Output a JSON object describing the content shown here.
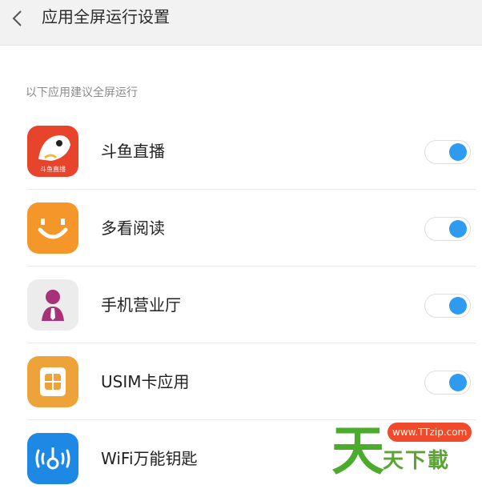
{
  "header": {
    "title": "应用全屏运行设置",
    "back_icon": "chevron-left-icon"
  },
  "section": {
    "label": "以下应用建议全屏运行"
  },
  "apps": [
    {
      "name": "斗鱼直播",
      "icon": "douyu-app-icon",
      "icon_caption": "斗鱼直播",
      "enabled": true
    },
    {
      "name": "多看阅读",
      "icon": "duokan-app-icon",
      "enabled": true
    },
    {
      "name": "手机营业厅",
      "icon": "business-hall-app-icon",
      "enabled": true
    },
    {
      "name": "USIM卡应用",
      "icon": "sim-card-app-icon",
      "enabled": true
    },
    {
      "name": "WiFi万能钥匙",
      "icon": "wifi-key-app-icon"
    }
  ],
  "watermark": {
    "url": "www.TTzip.com",
    "big_char": "天",
    "text": "天下載"
  },
  "colors": {
    "toggle_on": "#2f9bf0",
    "header_bg": "#f2f2f2",
    "douyu": "#e8432b",
    "duokan": "#f5962a",
    "sim": "#eea33a",
    "wifi": "#1e88e5",
    "watermark_green": "#4bab2a",
    "watermark_red": "#f04a2a"
  }
}
